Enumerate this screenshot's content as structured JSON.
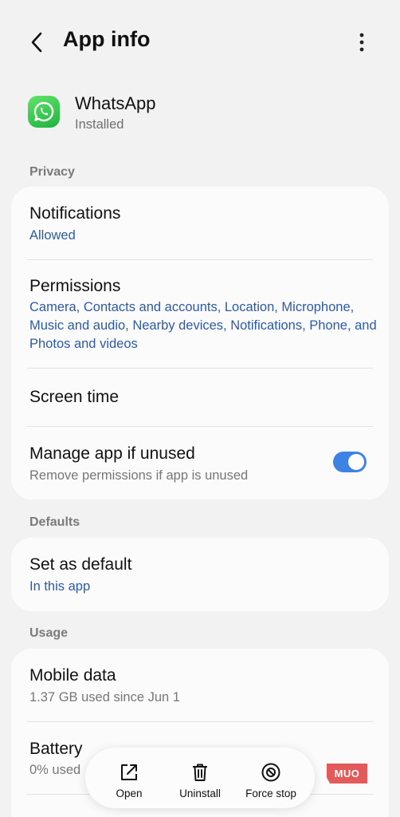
{
  "header": {
    "title": "App info"
  },
  "app": {
    "name": "WhatsApp",
    "status": "Installed"
  },
  "privacy": {
    "label": "Privacy",
    "notifications": {
      "title": "Notifications",
      "value": "Allowed"
    },
    "permissions": {
      "title": "Permissions",
      "value": "Camera, Contacts and accounts, Location, Microphone, Music and audio, Nearby devices, Notifications, Phone, and Photos and videos"
    },
    "screen_time": {
      "title": "Screen time"
    },
    "manage_unused": {
      "title": "Manage app if unused",
      "subtitle": "Remove permissions if app is unused",
      "enabled": true
    }
  },
  "defaults": {
    "label": "Defaults",
    "set_default": {
      "title": "Set as default",
      "value": "In this app"
    }
  },
  "usage": {
    "label": "Usage",
    "mobile_data": {
      "title": "Mobile data",
      "value": "1.37 GB used since Jun 1"
    },
    "battery": {
      "title": "Battery",
      "value": "0% used"
    }
  },
  "actions": {
    "open": "Open",
    "uninstall": "Uninstall",
    "force_stop": "Force stop"
  },
  "watermark": "MUO",
  "colors": {
    "accent": "#3e82e4",
    "link": "#2d5aa8",
    "whatsapp": "#25d366"
  }
}
